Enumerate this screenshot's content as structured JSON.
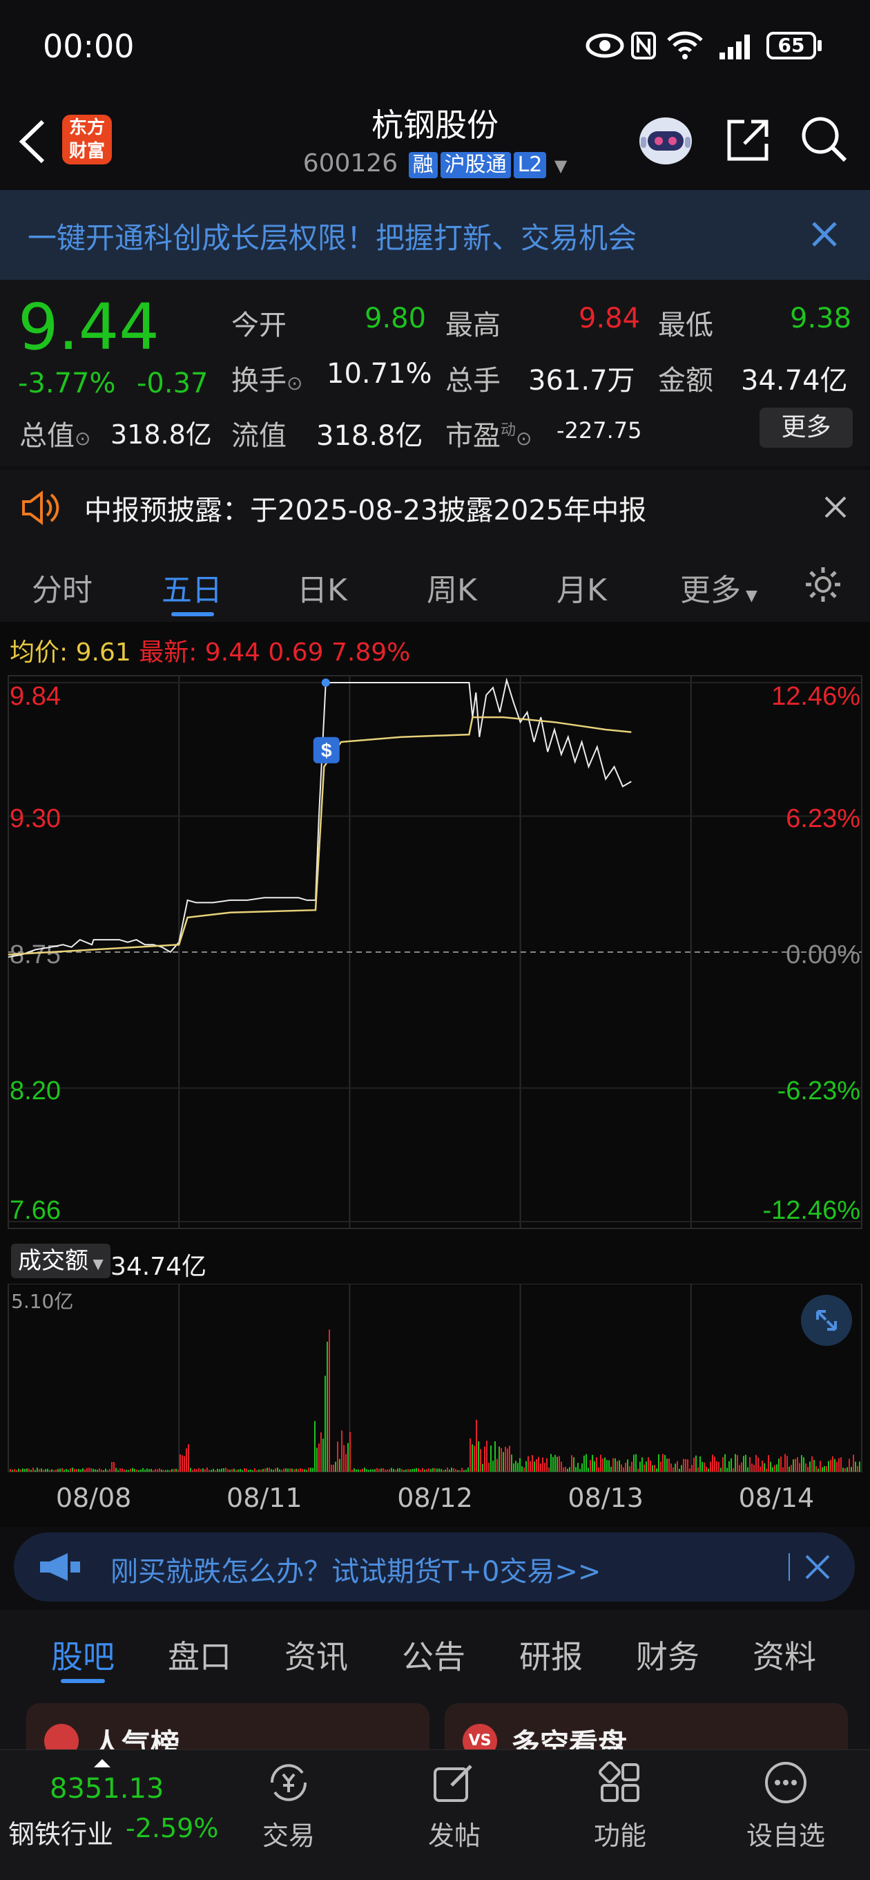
{
  "status_bar": {
    "time": "00:00",
    "battery": "65"
  },
  "header": {
    "logo_text_1": "东方",
    "logo_text_2": "财富",
    "title": "杭钢股份",
    "code": "600126",
    "tags": [
      "融",
      "沪股通",
      "L2"
    ]
  },
  "promo": {
    "text": "一键开通科创成长层权限！把握打新、交易机会"
  },
  "quote": {
    "price": "9.44",
    "pct": "-3.77%",
    "change": "-0.37",
    "open_label": "今开",
    "open": "9.80",
    "high_label": "最高",
    "high": "9.84",
    "low_label": "最低",
    "low": "9.38",
    "turnover_label": "换手",
    "turnover": "10.71%",
    "volume_label": "总手",
    "volume": "361.7万",
    "amount_label": "金额",
    "amount": "34.74亿",
    "mktcap_label": "总值",
    "mktcap": "318.8亿",
    "float_label": "流值",
    "float": "318.8亿",
    "pe_label": "市盈",
    "pe_sup": "动",
    "pe": "-227.75",
    "more_label": "更多"
  },
  "notice": {
    "text": "中报预披露：于2025-08-23披露2025年中报"
  },
  "chart_tabs": [
    "分时",
    "五日",
    "日K",
    "周K",
    "月K",
    "更多"
  ],
  "chart_tabs_active": 1,
  "legend": {
    "avg_label": "均价:",
    "avg": "9.61",
    "latest_label": "最新:",
    "latest": "9.44",
    "latest_chg": "0.69",
    "latest_pct": "7.89%"
  },
  "volume_header": {
    "selector": "成交额",
    "total": "34.74亿",
    "max": "5.10亿"
  },
  "chart_data": {
    "type": "line",
    "x_ticks": [
      "08/08",
      "08/11",
      "08/12",
      "08/13",
      "08/14"
    ],
    "y_left_ticks": [
      "9.84",
      "9.30",
      "8.75",
      "8.20",
      "7.66"
    ],
    "y_right_ticks": [
      "12.46%",
      "6.23%",
      "0.00%",
      "-6.23%",
      "-12.46%"
    ],
    "ylim": [
      7.66,
      9.84
    ],
    "base": 8.75,
    "series": [
      {
        "name": "price",
        "points": [
          [
            0,
            8.73
          ],
          [
            0.08,
            8.74
          ],
          [
            0.16,
            8.76
          ],
          [
            0.25,
            8.77
          ],
          [
            0.32,
            8.78
          ],
          [
            0.37,
            8.77
          ],
          [
            0.42,
            8.8
          ],
          [
            0.49,
            8.78
          ],
          [
            0.5,
            8.8
          ],
          [
            0.55,
            8.8
          ],
          [
            0.6,
            8.8
          ],
          [
            0.65,
            8.8
          ],
          [
            0.7,
            8.79
          ],
          [
            0.75,
            8.8
          ],
          [
            0.8,
            8.78
          ],
          [
            0.85,
            8.78
          ],
          [
            0.9,
            8.77
          ],
          [
            0.95,
            8.75
          ],
          [
            1.0,
            8.79
          ],
          [
            1.05,
            8.96
          ],
          [
            1.1,
            8.95
          ],
          [
            1.2,
            8.95
          ],
          [
            1.3,
            8.96
          ],
          [
            1.4,
            8.96
          ],
          [
            1.5,
            8.97
          ],
          [
            1.6,
            8.97
          ],
          [
            1.7,
            8.97
          ],
          [
            1.75,
            8.96
          ],
          [
            1.8,
            8.96
          ],
          [
            1.82,
            9.3
          ],
          [
            1.86,
            9.84
          ],
          [
            2.0,
            9.84
          ],
          [
            2.2,
            9.84
          ],
          [
            2.7,
            9.84
          ],
          [
            2.72,
            9.7
          ],
          [
            2.74,
            9.8
          ],
          [
            2.76,
            9.62
          ],
          [
            2.8,
            9.79
          ],
          [
            2.84,
            9.82
          ],
          [
            2.88,
            9.72
          ],
          [
            2.92,
            9.85
          ],
          [
            2.96,
            9.76
          ],
          [
            3.0,
            9.68
          ],
          [
            3.04,
            9.72
          ],
          [
            3.08,
            9.6
          ],
          [
            3.12,
            9.7
          ],
          [
            3.16,
            9.56
          ],
          [
            3.2,
            9.65
          ],
          [
            3.24,
            9.55
          ],
          [
            3.28,
            9.62
          ],
          [
            3.32,
            9.52
          ],
          [
            3.36,
            9.6
          ],
          [
            3.4,
            9.5
          ],
          [
            3.45,
            9.58
          ],
          [
            3.5,
            9.45
          ],
          [
            3.55,
            9.5
          ],
          [
            3.6,
            9.42
          ],
          [
            3.65,
            9.44
          ]
        ]
      },
      {
        "name": "avg",
        "points": [
          [
            0,
            8.74
          ],
          [
            0.5,
            8.76
          ],
          [
            1.0,
            8.78
          ],
          [
            1.05,
            8.89
          ],
          [
            1.3,
            8.91
          ],
          [
            1.8,
            8.92
          ],
          [
            1.85,
            9.5
          ],
          [
            1.95,
            9.6
          ],
          [
            2.3,
            9.62
          ],
          [
            2.7,
            9.63
          ],
          [
            2.72,
            9.7
          ],
          [
            2.9,
            9.7
          ],
          [
            3.2,
            9.68
          ],
          [
            3.5,
            9.65
          ],
          [
            3.65,
            9.64
          ]
        ]
      }
    ]
  },
  "tip": {
    "text": "刚买就跌怎么办？试试期货T+0交易>>"
  },
  "info_tabs": [
    "股吧",
    "盘口",
    "资讯",
    "公告",
    "研报",
    "财务",
    "资料"
  ],
  "info_tabs_active": 0,
  "cards": {
    "left": "人气榜",
    "right": "多空看盘"
  },
  "bottom_nav": {
    "index_value": "8351.13",
    "sector": "钢铁行业",
    "sector_pct": "-2.59%",
    "items": [
      "交易",
      "发帖",
      "功能",
      "设自选"
    ]
  },
  "colors": {
    "red": "#e8222a",
    "green": "#1ec31e",
    "accent": "#2f6fd8",
    "avg_line": "#e8d27a"
  }
}
